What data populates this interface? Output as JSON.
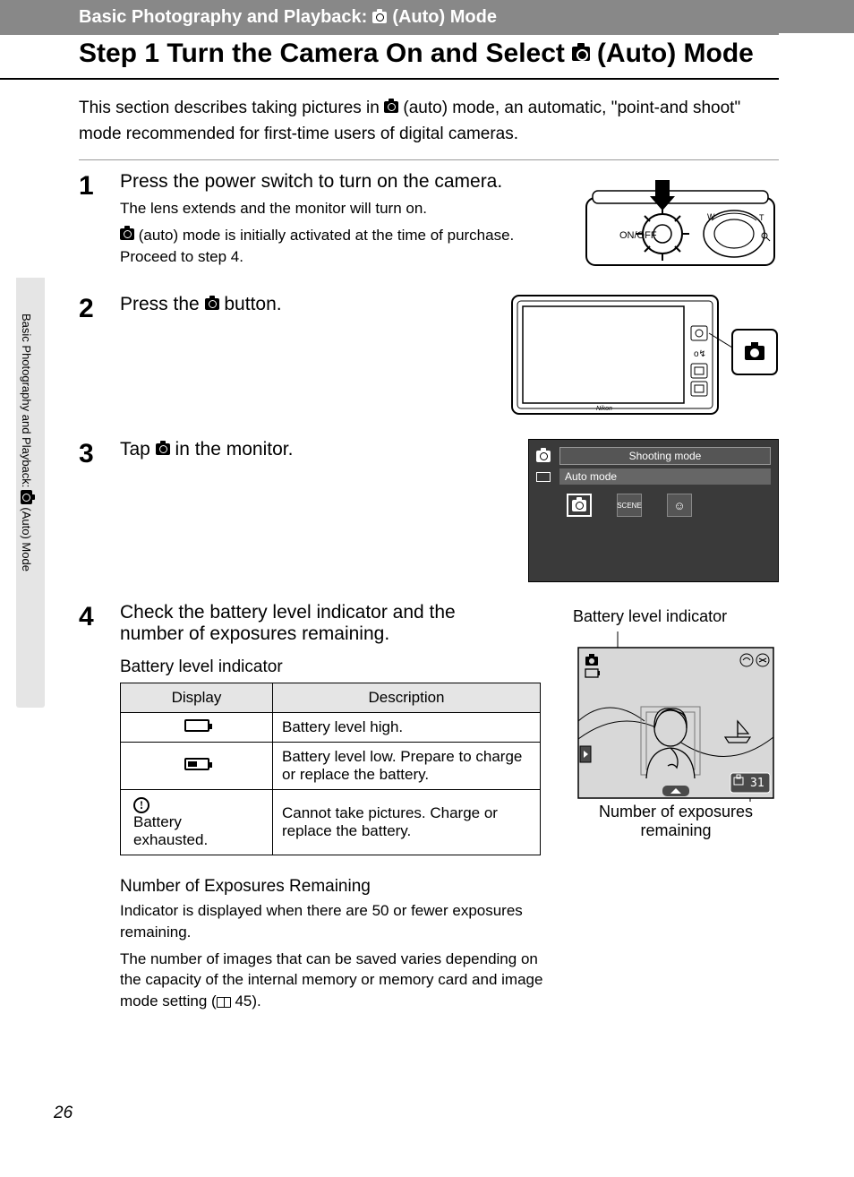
{
  "banner": {
    "prefix": "Basic Photography and Playback:",
    "suffix": "(Auto) Mode"
  },
  "title": {
    "prefix": "Step 1 Turn the Camera On and Select",
    "suffix": "(Auto) Mode"
  },
  "intro": {
    "part1": "This section describes taking pictures in ",
    "part2": " (auto) mode, an automatic, \"point-and shoot\" mode recommended for first-time users of digital cameras."
  },
  "sidebar_tab": {
    "prefix": "Basic Photography and Playback: ",
    "suffix": " (Auto) Mode"
  },
  "steps": [
    {
      "num": "1",
      "title": "Press the power switch to turn on the camera.",
      "sub1": "The lens extends and the monitor will turn on.",
      "sub2_prefix": "",
      "sub2_suffix": " (auto) mode is initially activated at the time of purchase. Proceed to step 4.",
      "illus_label": "ON/OFF",
      "illus_w": "W",
      "illus_t": "T"
    },
    {
      "num": "2",
      "title_prefix": "Press the ",
      "title_suffix": " button."
    },
    {
      "num": "3",
      "title_prefix": "Tap ",
      "title_suffix": " in the monitor.",
      "monitor": {
        "header": "Shooting mode",
        "sub": "Auto mode",
        "scene": "SCENE"
      }
    },
    {
      "num": "4",
      "title": "Check the battery level indicator and the number of exposures remaining.",
      "subhead": "Battery level indicator",
      "table": {
        "col1": "Display",
        "col2": "Description",
        "rows": [
          {
            "desc": "Battery level high."
          },
          {
            "desc": "Battery level low. Prepare to charge or replace the battery."
          },
          {
            "disp_line1": "Battery",
            "disp_line2": "exhausted.",
            "desc": "Cannot take pictures. Charge or replace the battery."
          }
        ]
      },
      "side": {
        "caption1": "Battery level indicator",
        "caption2": "Number of exposures remaining",
        "remaining": "31"
      },
      "exposures": {
        "heading": "Number of Exposures Remaining",
        "line1": "Indicator is displayed when there are 50 or fewer exposures remaining.",
        "line2_prefix": "The number of images that can be saved varies depending on the capacity of the internal memory or memory card and image mode setting (",
        "line2_ref": " 45).",
        "line2_suffix": ""
      }
    }
  ],
  "page_number": "26"
}
